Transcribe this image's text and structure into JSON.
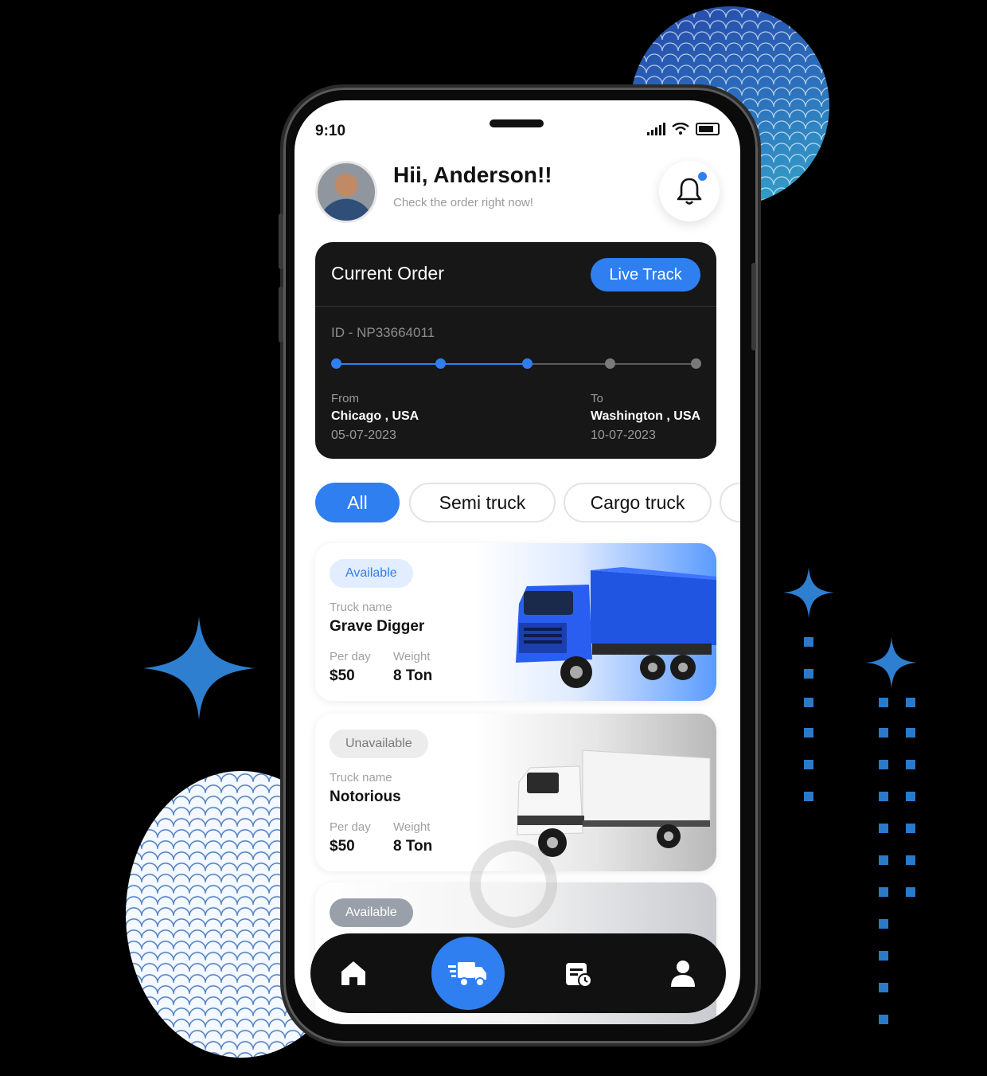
{
  "status_bar": {
    "time": "9:10"
  },
  "header": {
    "greeting": "Hii, Anderson!!",
    "subtitle": "Check the order right now!"
  },
  "current_order": {
    "title": "Current Order",
    "live_track_label": "Live Track",
    "order_id": "ID - NP33664011",
    "progress_stops_total": 5,
    "progress_stops_completed": 3,
    "from_label": "From",
    "from_city": "Chicago , USA",
    "from_date": "05-07-2023",
    "to_label": "To",
    "to_city": "Washington , USA",
    "to_date": "10-07-2023"
  },
  "filters": {
    "chips": [
      "All",
      "Semi truck",
      "Cargo truck"
    ],
    "selected": "All"
  },
  "trucks": [
    {
      "status": "Available",
      "name_label": "Truck name",
      "name": "Grave Digger",
      "price_label": "Per day",
      "price": "$50",
      "weight_label": "Weight",
      "weight": "8 Ton"
    },
    {
      "status": "Unavailable",
      "name_label": "Truck name",
      "name": "Notorious",
      "price_label": "Per day",
      "price": "$50",
      "weight_label": "Weight",
      "weight": "8 Ton"
    },
    {
      "status": "Available"
    }
  ],
  "bottom_nav": {
    "items": [
      "home-icon",
      "truck-delivery-icon",
      "schedule-icon",
      "profile-icon"
    ],
    "active": "truck-delivery-icon"
  },
  "colors": {
    "accent": "#2f7ff0",
    "card_dark": "#171717",
    "deco_blue": "#2a63b5"
  }
}
